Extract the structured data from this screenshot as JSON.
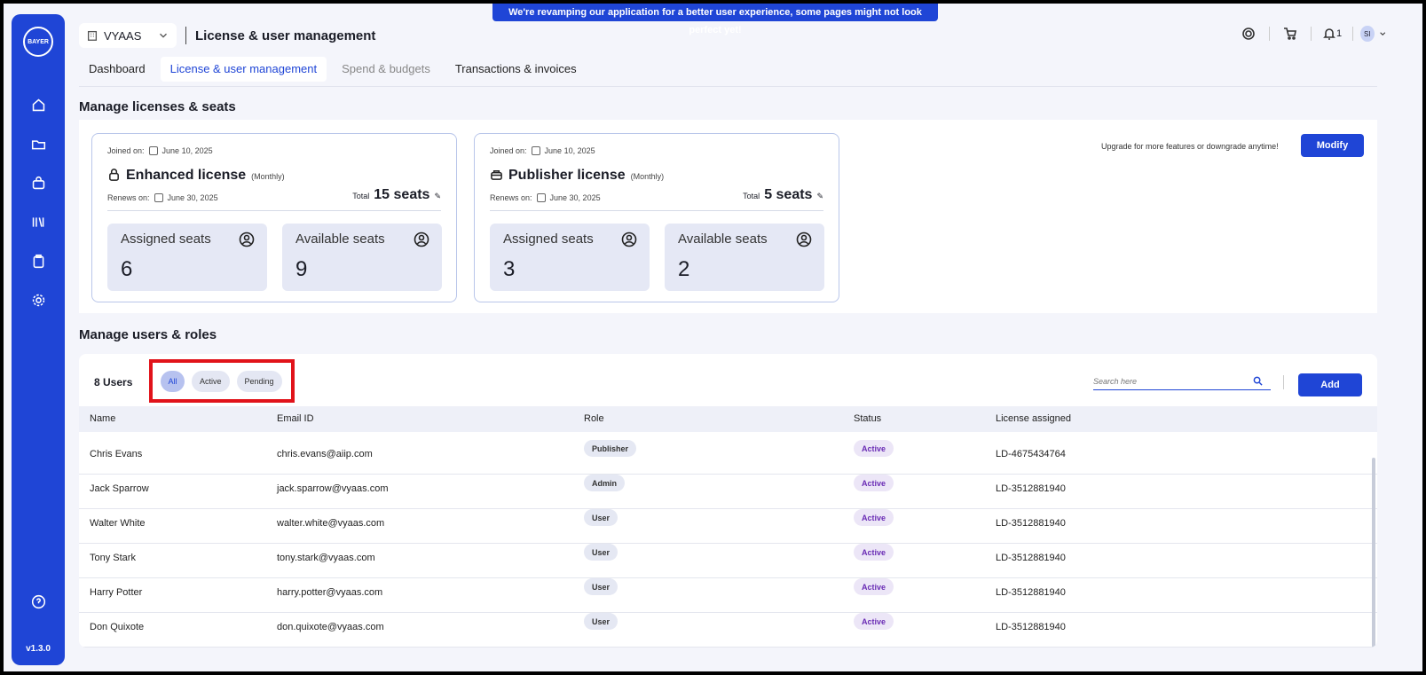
{
  "banner": "We're revamping our application for a better user experience, some pages might not look perfect yet!",
  "sidebar": {
    "logo_text": "BAYER",
    "items": [
      "home-icon",
      "folder-icon",
      "bag-icon",
      "library-icon",
      "clipboard-icon",
      "settings-icon"
    ],
    "help_icon": "help-icon",
    "version": "v1.3.0"
  },
  "header": {
    "org": "VYAAS",
    "title": "License & user management",
    "notifications_count": "1",
    "user_initials": "SI"
  },
  "tabs": [
    {
      "label": "Dashboard"
    },
    {
      "label": "License & user management",
      "active": true
    },
    {
      "label": "Spend & budgets"
    },
    {
      "label": "Transactions & invoices"
    }
  ],
  "licenses": {
    "title": "Manage licenses & seats",
    "upgrade_text": "Upgrade for more features or downgrade anytime!",
    "modify_label": "Modify",
    "joined_label": "Joined on:",
    "renews_label": "Renews on:",
    "total_label": "Total",
    "assigned_label": "Assigned seats",
    "available_label": "Available seats",
    "cards": [
      {
        "name": "Enhanced license",
        "period": "(Monthly)",
        "joined": "June 10, 2025",
        "renews": "June 30, 2025",
        "total": "15 seats",
        "assigned": "6",
        "available": "9"
      },
      {
        "name": "Publisher license",
        "period": "(Monthly)",
        "joined": "June 10, 2025",
        "renews": "June 30, 2025",
        "total": "5 seats",
        "assigned": "3",
        "available": "2"
      }
    ]
  },
  "users": {
    "title": "Manage users & roles",
    "count_label": "8 Users",
    "filters": [
      "All",
      "Active",
      "Pending"
    ],
    "search_placeholder": "Search here",
    "add_label": "Add",
    "columns": [
      "Name",
      "Email ID",
      "Role",
      "Status",
      "License assigned"
    ],
    "rows": [
      {
        "name": "Chris Evans",
        "email": "chris.evans@aiip.com",
        "role": "Publisher",
        "status": "Active",
        "license": "LD-4675434764"
      },
      {
        "name": "Jack Sparrow",
        "email": "jack.sparrow@vyaas.com",
        "role": "Admin",
        "status": "Active",
        "license": "LD-3512881940"
      },
      {
        "name": "Walter White",
        "email": "walter.white@vyaas.com",
        "role": "User",
        "status": "Active",
        "license": "LD-3512881940"
      },
      {
        "name": "Tony Stark",
        "email": "tony.stark@vyaas.com",
        "role": "User",
        "status": "Active",
        "license": "LD-3512881940"
      },
      {
        "name": "Harry Potter",
        "email": "harry.potter@vyaas.com",
        "role": "User",
        "status": "Active",
        "license": "LD-3512881940"
      },
      {
        "name": "Don Quixote",
        "email": "don.quixote@vyaas.com",
        "role": "User",
        "status": "Active",
        "license": "LD-3512881940"
      }
    ]
  },
  "colors": {
    "accent": "#1f45d6",
    "highlight": "#e1131a",
    "status_active": "#6a2cb5"
  }
}
